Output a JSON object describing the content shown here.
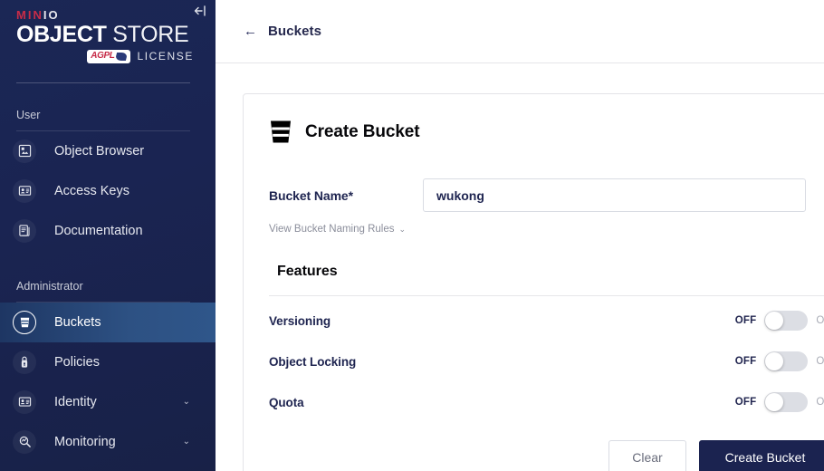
{
  "sidebar": {
    "logo": {
      "brand_prefix": "MIN",
      "brand_suffix": "IO",
      "product_bold": "OBJECT",
      "product_light": " STORE",
      "agpl_label": "AGPL",
      "license_label": "LICENSE"
    },
    "collapse_icon": "collapse-sidebar-icon",
    "sections": [
      {
        "label": "User",
        "items": [
          {
            "label": "Object Browser",
            "icon": "object-browser-icon",
            "active": false,
            "expandable": false
          },
          {
            "label": "Access Keys",
            "icon": "access-keys-icon",
            "active": false,
            "expandable": false
          },
          {
            "label": "Documentation",
            "icon": "documentation-icon",
            "active": false,
            "expandable": false
          }
        ]
      },
      {
        "label": "Administrator",
        "items": [
          {
            "label": "Buckets",
            "icon": "bucket-icon",
            "active": true,
            "expandable": false
          },
          {
            "label": "Policies",
            "icon": "policies-icon",
            "active": false,
            "expandable": false
          },
          {
            "label": "Identity",
            "icon": "identity-icon",
            "active": false,
            "expandable": true
          },
          {
            "label": "Monitoring",
            "icon": "monitoring-icon",
            "active": false,
            "expandable": true
          }
        ]
      }
    ],
    "chevron": "⌄"
  },
  "topbar": {
    "back_icon": "←",
    "title": "Buckets"
  },
  "card": {
    "icon": "bucket-icon",
    "title": "Create Bucket",
    "bucket_name": {
      "label": "Bucket Name*",
      "value": "wukong",
      "placeholder": ""
    },
    "naming_rules": {
      "label": "View Bucket Naming Rules",
      "chevron": "⌄"
    },
    "features": {
      "title": "Features",
      "on_label": "ON",
      "off_label": "OFF",
      "rows": [
        {
          "label": "Versioning",
          "state": "OFF"
        },
        {
          "label": "Object Locking",
          "state": "OFF"
        },
        {
          "label": "Quota",
          "state": "OFF"
        }
      ]
    },
    "buttons": {
      "clear": "Clear",
      "create": "Create Bucket"
    }
  },
  "colors": {
    "sidebar_bg": "#1b2755",
    "sidebar_active": "#2d5183",
    "brand_red": "#c72c48",
    "primary_navy": "#1b2350",
    "text_navy": "#1e2450"
  }
}
